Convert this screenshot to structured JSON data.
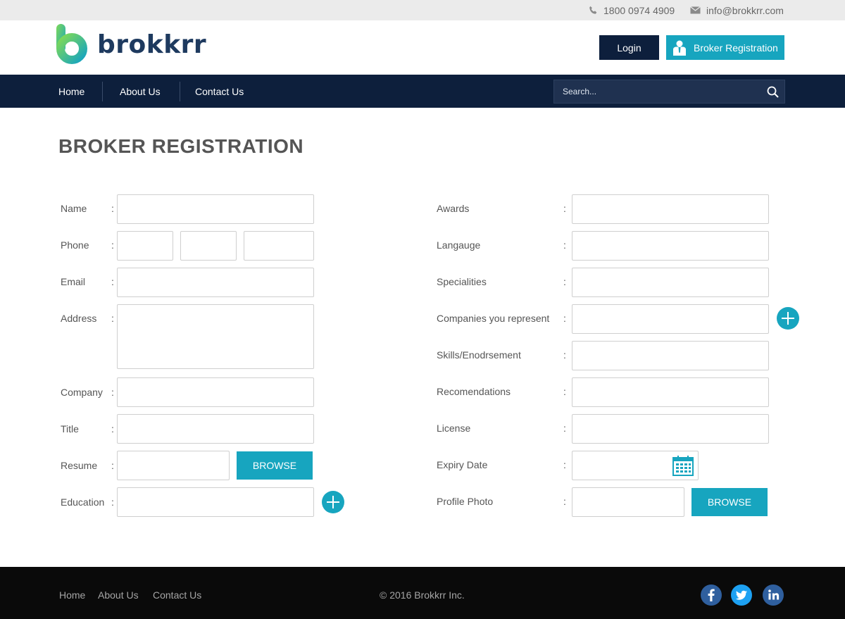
{
  "topbar": {
    "phone": "1800 0974 4909",
    "email": "info@brokkrr.com"
  },
  "header": {
    "logo_text": "brokkrr",
    "login_label": "Login",
    "broker_registration_label": "Broker Registration"
  },
  "nav": {
    "items": [
      "Home",
      "About Us",
      "Contact Us"
    ],
    "search_placeholder": "Search..."
  },
  "page": {
    "title": "BROKER REGISTRATION"
  },
  "form": {
    "left": [
      {
        "label": "Name"
      },
      {
        "label": "Phone"
      },
      {
        "label": "Email"
      },
      {
        "label": "Address"
      },
      {
        "label": "Company"
      },
      {
        "label": "Title"
      },
      {
        "label": "Resume"
      },
      {
        "label": "Education"
      }
    ],
    "right": [
      {
        "label": "Awards"
      },
      {
        "label": "Langauge"
      },
      {
        "label": "Specialities"
      },
      {
        "label": "Companies you represent"
      },
      {
        "label": "Skills/Enodrsement"
      },
      {
        "label": "Recomendations"
      },
      {
        "label": "License"
      },
      {
        "label": "Expiry Date"
      },
      {
        "label": "Profile Photo"
      }
    ],
    "separator": ":",
    "browse_label": "BROWSE"
  },
  "footer": {
    "links": [
      "Home",
      "About Us",
      "Contact Us"
    ],
    "copyright": "© 2016 Brokkrr Inc.",
    "social": [
      "facebook-icon",
      "twitter-icon",
      "linkedin-icon"
    ]
  },
  "colors": {
    "accent": "#17a5bf",
    "navy": "#0d1f3c",
    "footer": "#0a0a0a"
  }
}
